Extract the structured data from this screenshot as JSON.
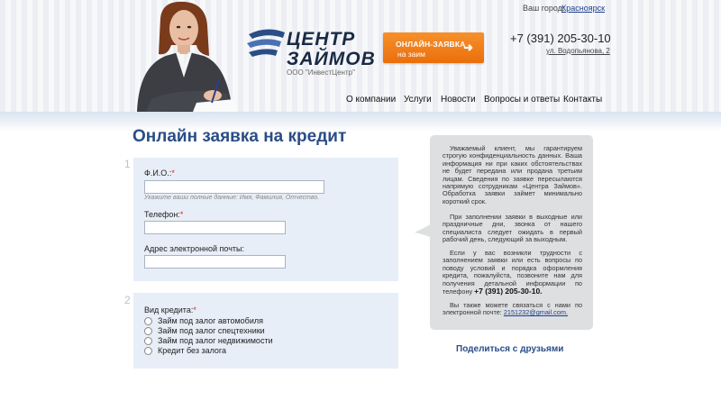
{
  "header": {
    "city_label": "Ваш город:",
    "city_value": "Красноярск",
    "logo_line1": "ЦЕНТР",
    "logo_line2": "ЗАЙМОВ",
    "logo_sub": "ООО \"ИнвестЦентр\"",
    "cta_line1": "ОНЛАЙН-ЗАЯВКА",
    "cta_line2": "на заим",
    "phone": "+7 (391) 205-30-10",
    "address": "ул. Водопьянова, 2"
  },
  "nav": {
    "items": [
      "О компании",
      "Услуги",
      "Новости",
      "Вопросы и ответы",
      "Контакты"
    ]
  },
  "page_title": "Онлайн заявка на кредит",
  "form": {
    "step1": "1",
    "step2": "2",
    "fio_label": "Ф.И.О.:",
    "fio_hint": "Укажите ваши полные данные: Имя, Фамилия, Отчество.",
    "fio_value": "",
    "phone_label": "Телефон:",
    "phone_value": "",
    "email_label": "Адрес электронной почты:",
    "email_value": "",
    "credit_label": "Вид кредита:",
    "credit_options": [
      "Займ под залог автомобиля",
      "Займ под залог спецтехники",
      "Займ под залог недвижимости",
      "Кредит без залога"
    ],
    "required_mark": "*"
  },
  "info": {
    "p1": "Уважаемый клиент, мы гарантируем строгую конфиденциальность данных. Ваша информация ни при каких обстоятельствах не будет передана или продана третьим лицам. Сведения по заявке пересылаются напрямую сотрудникам «Центра Займов». Обработка заявки займет минимально короткий срок.",
    "p2": "При заполнении заявки в выходные или праздничные дни, звонка от нашего специалиста следует ожидать в первый рабочий день, следующий за выходным.",
    "p3": "Если у вас возникли трудности с заполнением заявки или есть вопросы по поводу условий и порядка оформления кредита, пожалуйста, позвоните нам для получения детальной информации по телефону",
    "p3_phone": "+7 (391) 205-30-10.",
    "p4": "Вы также можете связаться с нами по электронной почте:",
    "p4_email": "2151232@gmail.com."
  },
  "share": "Поделиться с друзьями",
  "colors": {
    "accent_blue": "#2a4d86",
    "cta_orange": "#f08020",
    "panel_bg": "#e7eef7",
    "info_bg": "#dedfe1"
  }
}
